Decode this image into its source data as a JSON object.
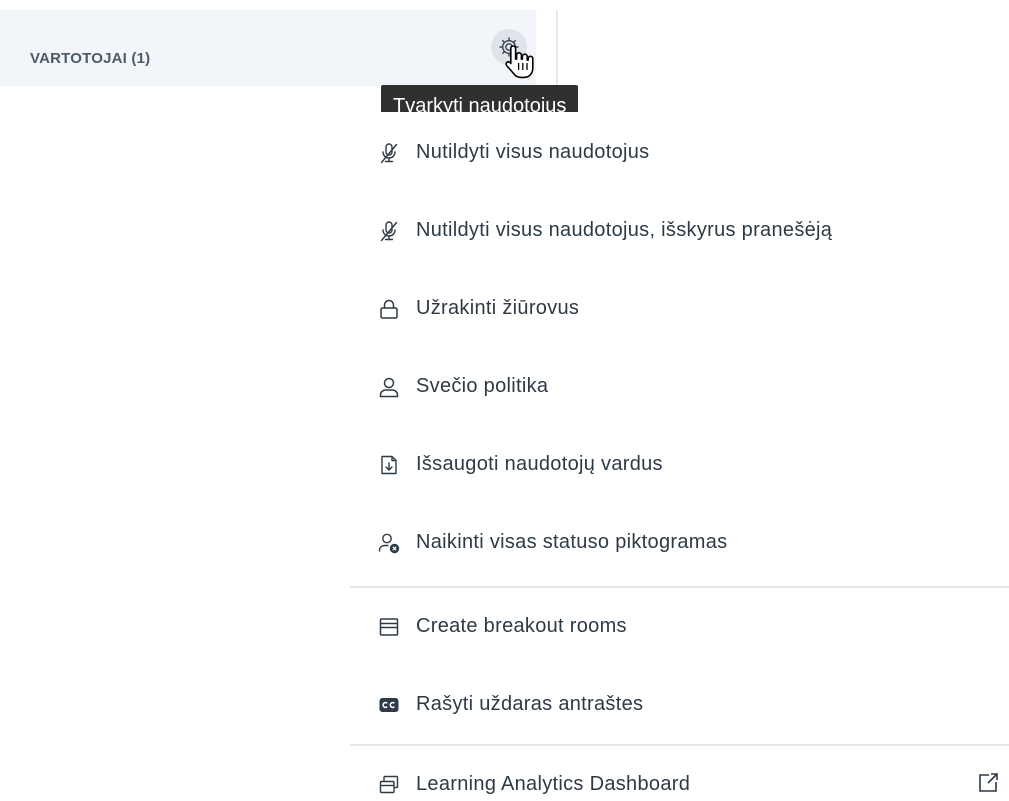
{
  "users_panel": {
    "title": "VARTOTOJAI (1)",
    "settings_icon": "gear-icon"
  },
  "tooltip": {
    "text": "Tvarkyti naudotojus"
  },
  "menu": {
    "items": [
      {
        "label": "Nutildyti visus naudotojus",
        "icon": "mic-off-icon"
      },
      {
        "label": "Nutildyti visus naudotojus, išskyrus pranešėją",
        "icon": "mic-off-icon"
      },
      {
        "label": "Užrakinti žiūrovus",
        "icon": "lock-icon"
      },
      {
        "label": "Svečio politika",
        "icon": "user-icon"
      },
      {
        "label": "Išsaugoti naudotojų vardus",
        "icon": "download-file-icon"
      },
      {
        "label": "Naikinti visas statuso piktogramas",
        "icon": "clear-status-icon"
      },
      {
        "label": "Create breakout rooms",
        "icon": "rooms-icon"
      },
      {
        "label": "Rašyti uždaras antraštes",
        "icon": "closed-captions-icon"
      },
      {
        "label": "Learning Analytics Dashboard",
        "icon": "dashboard-icon",
        "trailing_icon": "external-link-icon"
      }
    ]
  },
  "colors": {
    "header_bg": "#f2f5f9",
    "tooltip_bg": "#303030",
    "menu_text": "#2e3a46",
    "separator": "#e3e6ea"
  }
}
